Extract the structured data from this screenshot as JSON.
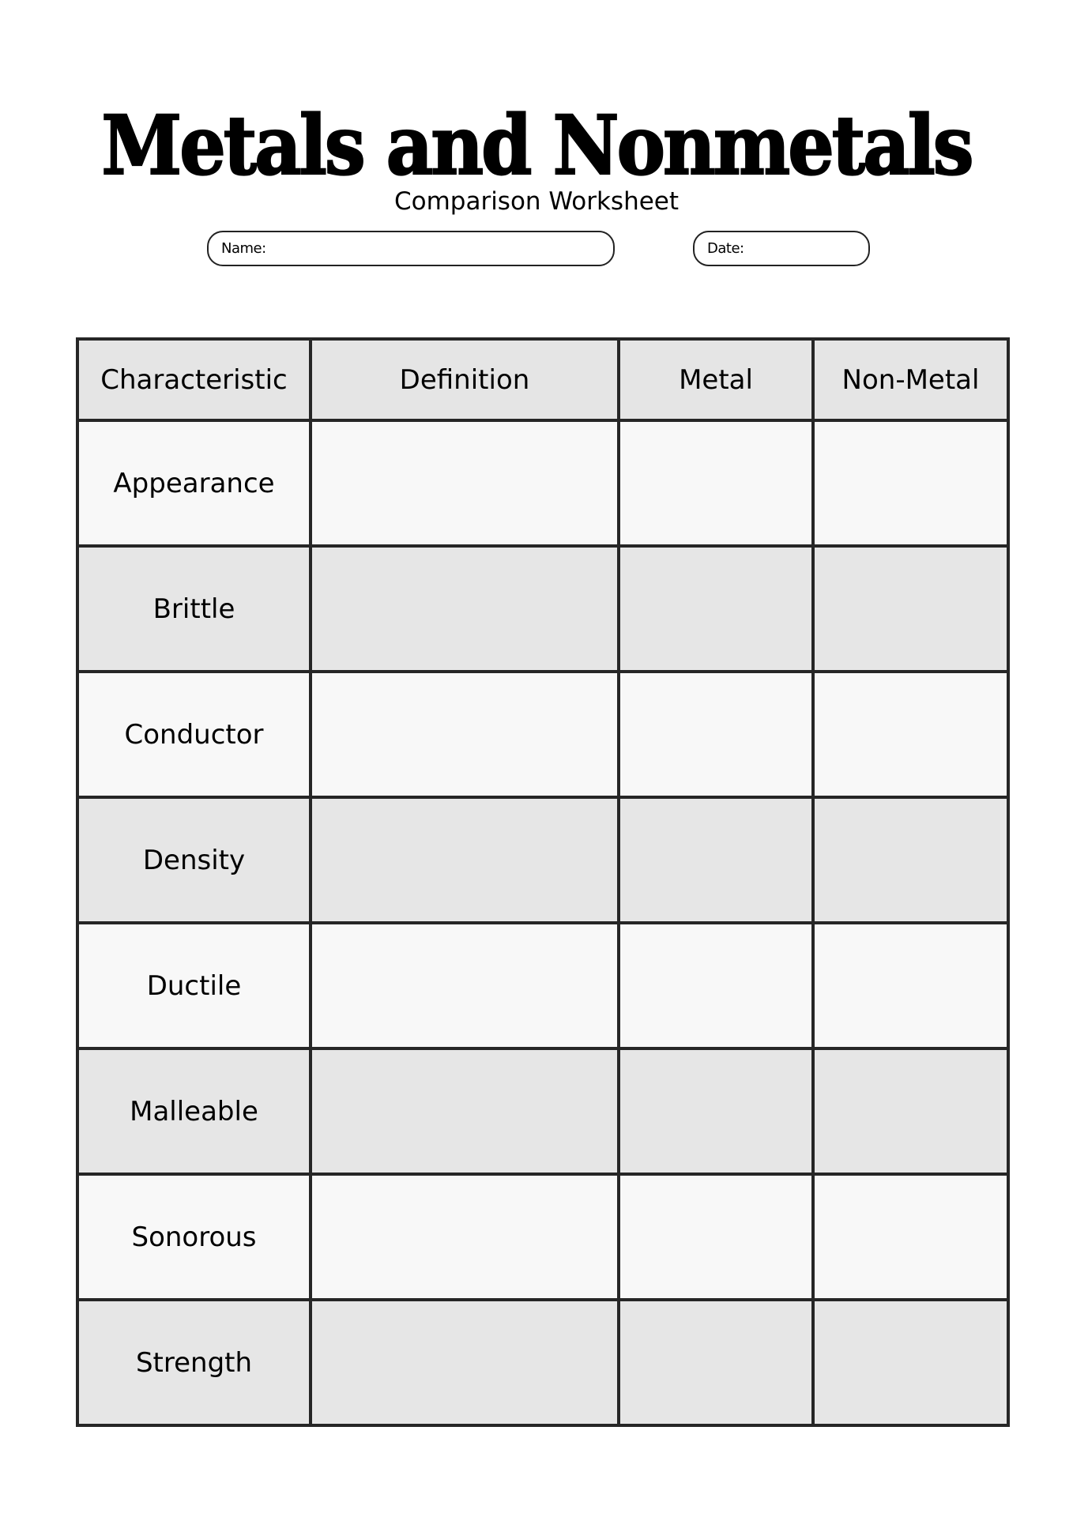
{
  "header": {
    "title": "Metals and Nonmetals",
    "subtitle": "Comparison Worksheet"
  },
  "fields": {
    "name_label": "Name:",
    "name_value": "",
    "date_label": "Date:",
    "date_value": ""
  },
  "table": {
    "columns": [
      "Characteristic",
      "Definition",
      "Metal",
      "Non-Metal"
    ],
    "rows": [
      {
        "characteristic": "Appearance",
        "definition": "",
        "metal": "",
        "non_metal": ""
      },
      {
        "characteristic": "Brittle",
        "definition": "",
        "metal": "",
        "non_metal": ""
      },
      {
        "characteristic": "Conductor",
        "definition": "",
        "metal": "",
        "non_metal": ""
      },
      {
        "characteristic": "Density",
        "definition": "",
        "metal": "",
        "non_metal": ""
      },
      {
        "characteristic": "Ductile",
        "definition": "",
        "metal": "",
        "non_metal": ""
      },
      {
        "characteristic": "Malleable",
        "definition": "",
        "metal": "",
        "non_metal": ""
      },
      {
        "characteristic": "Sonorous",
        "definition": "",
        "metal": "",
        "non_metal": ""
      },
      {
        "characteristic": "Strength",
        "definition": "",
        "metal": "",
        "non_metal": ""
      }
    ]
  },
  "colors": {
    "header_bg": "#e5e5e5",
    "row_light": "#f8f8f8",
    "row_dark": "#e6e6e6",
    "border": "#262626"
  }
}
